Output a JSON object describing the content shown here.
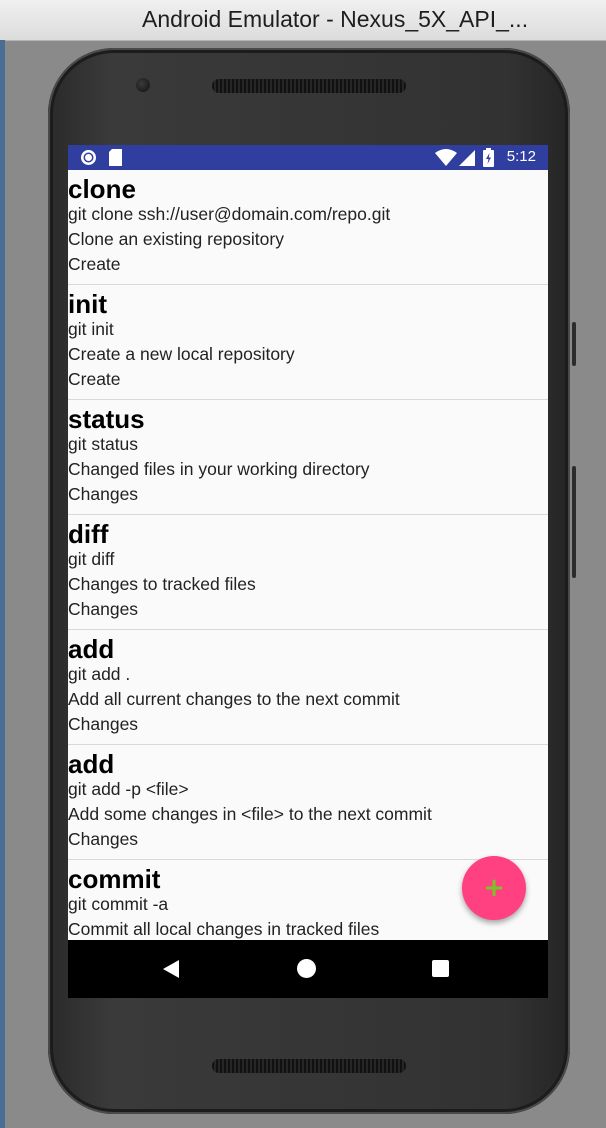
{
  "window": {
    "title": "Android Emulator - Nexus_5X_API_..."
  },
  "status_bar": {
    "time": "5:12",
    "left_icons": [
      "record-icon",
      "sd-card-icon"
    ],
    "right_icons": [
      "wifi-icon",
      "signal-icon",
      "battery-icon"
    ],
    "color": "#303f9f"
  },
  "commands": [
    {
      "name": "clone",
      "command": "git clone ssh://user@domain.com/repo.git",
      "description": "Clone an existing repository",
      "category": "Create"
    },
    {
      "name": "init",
      "command": "git init",
      "description": "Create a new local repository",
      "category": "Create"
    },
    {
      "name": "status",
      "command": "git status",
      "description": "Changed files in your working directory",
      "category": "Changes"
    },
    {
      "name": "diff",
      "command": "git diff",
      "description": "Changes to tracked files",
      "category": "Changes"
    },
    {
      "name": "add",
      "command": "git add .",
      "description": "Add all current changes to the next commit",
      "category": "Changes"
    },
    {
      "name": "add",
      "command": "git add -p <file>",
      "description": "Add some changes in <file> to the next commit",
      "category": "Changes"
    },
    {
      "name": "commit",
      "command": "git commit -a",
      "description": "Commit all local changes in tracked files",
      "category": ""
    }
  ],
  "fab": {
    "icon": "plus-icon",
    "glyph": "+",
    "color": "#ff4081"
  },
  "nav_bar": {
    "icons": [
      "back-icon",
      "home-icon",
      "recents-icon"
    ]
  }
}
